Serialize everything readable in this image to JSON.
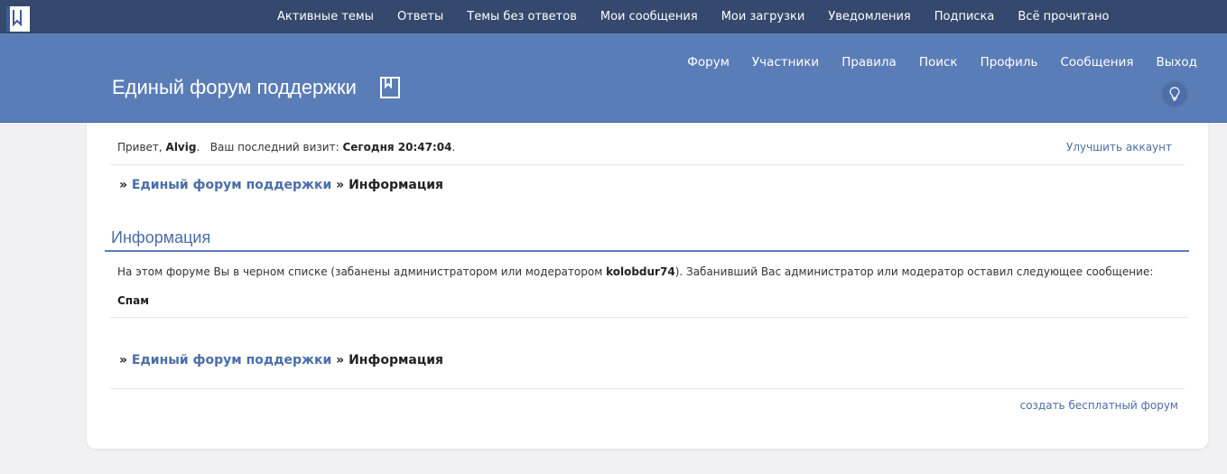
{
  "topnav": {
    "items": [
      "Активные темы",
      "Ответы",
      "Темы без ответов",
      "Мои сообщения",
      "Мои загрузки",
      "Уведомления",
      "Подписка",
      "Всё прочитано"
    ]
  },
  "header": {
    "title": "Единый форум поддержки",
    "nav": [
      "Форум",
      "Участники",
      "Правила",
      "Поиск",
      "Профиль",
      "Сообщения",
      "Выход"
    ]
  },
  "welcome": {
    "hello": "Привет,",
    "username": "Alvig",
    "dot": ".",
    "last_visit_label": "Ваш последний визит:",
    "last_visit_value": "Сегодня 20:47:04",
    "dot2": ".",
    "upgrade": "Улучшить аккаунт"
  },
  "breadcrumb": {
    "sep": "»",
    "forum": "Единый форум поддержки",
    "current": "Информация"
  },
  "info": {
    "title": "Информация",
    "text_before": "На этом форуме Вы в черном списке (забанены администратором или модератором ",
    "moderator": "kolobdur74",
    "text_after": "). Забанивший Вас администратор или модератор оставил следующее сообщение:",
    "reason": "Спам"
  },
  "footer": {
    "link": "создать бесплатный форум"
  },
  "colors": {
    "topbar": "#35486e",
    "header": "#5a7db7",
    "link": "#4a6ea9"
  },
  "icons": {
    "logo": "forum-logo-icon",
    "title_icon": "bookmark-icon",
    "theme": "lightbulb-icon"
  }
}
